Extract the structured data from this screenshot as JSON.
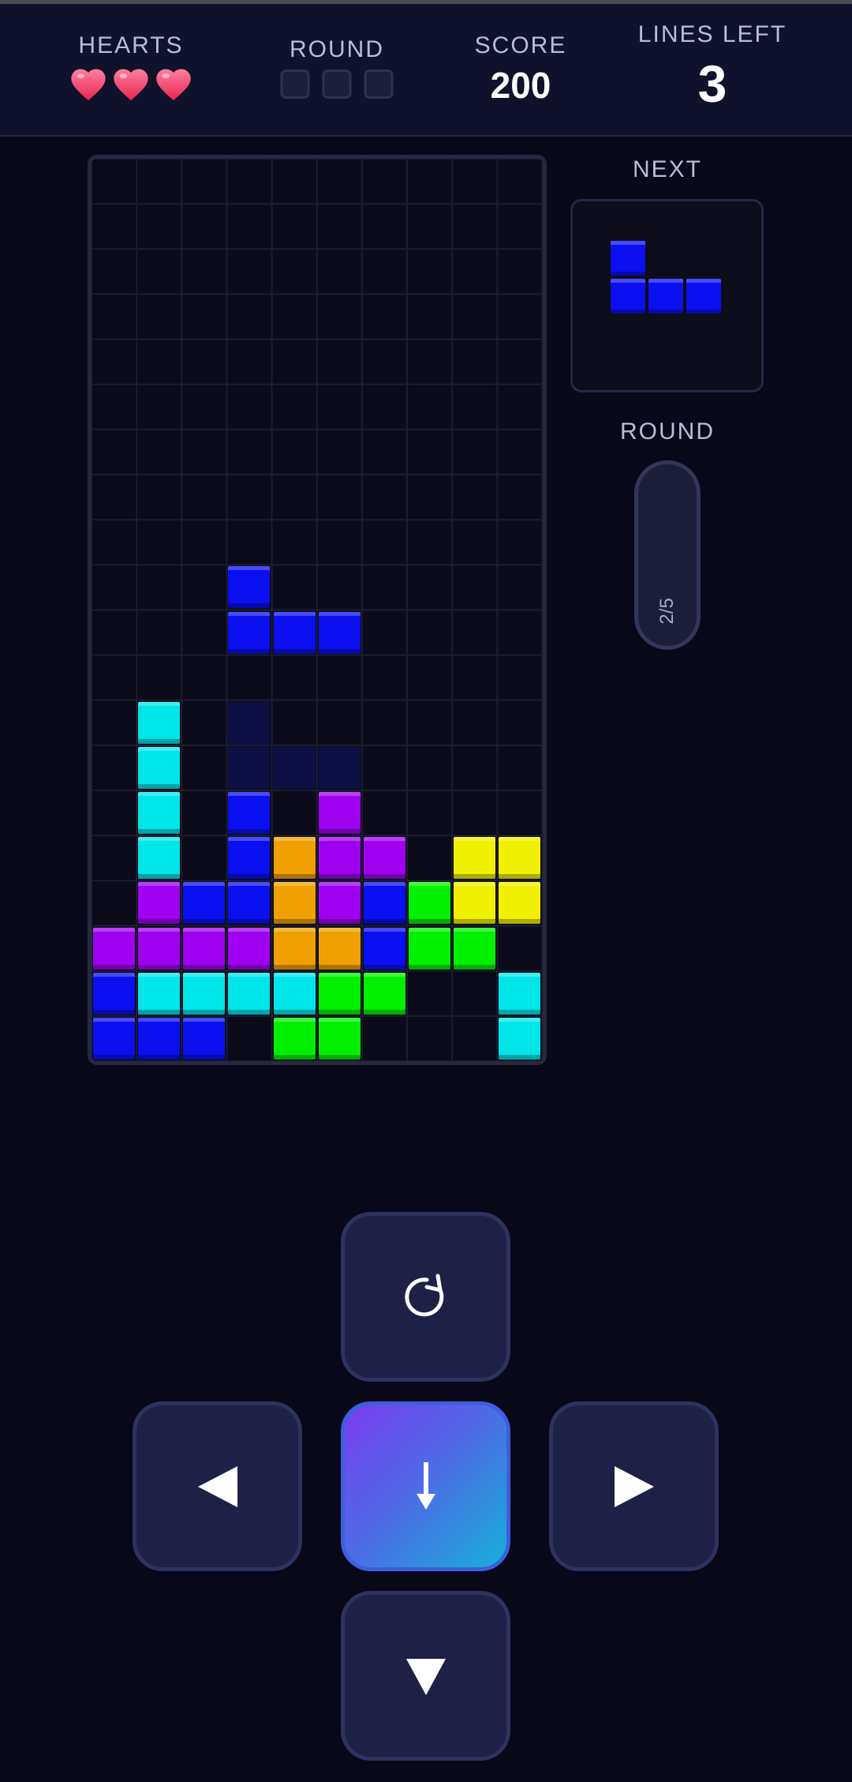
{
  "hud": {
    "hearts_label": "HEARTS",
    "hearts_count": 3,
    "round_label": "ROUND",
    "round_pips_total": 3,
    "round_pips_filled": 0,
    "score_label": "SCORE",
    "score_value": "200",
    "lines_label": "LINES LEFT",
    "lines_value": "3"
  },
  "sidebar": {
    "next_label": "NEXT",
    "next_piece": "J",
    "round_label": "ROUND",
    "round_progress": "2/5"
  },
  "colors": {
    "I": "#00e5e8",
    "J": "#0a10f0",
    "L": "#f0a000",
    "O": "#f0f000",
    "S": "#00f000",
    "T": "#a000f0",
    "ghost": "#0d0f45"
  },
  "board": {
    "cols": 10,
    "rows": 20,
    "rows_data": [
      "..........",
      "..........",
      "..........",
      "..........",
      "..........",
      "..........",
      "..........",
      "..........",
      "..........",
      "...J......",
      "...JJJ....",
      "..........",
      ".I.g......",
      ".I.ggg....",
      ".I.J.T....",
      ".I.JLTT.OO",
      ".TJJLTJSOO",
      "TTTTLLJSS.",
      "JIIIISS..I",
      "JJJ.SS...I"
    ]
  },
  "controls": {
    "rotate": "rotate-button",
    "left": "move-left-button",
    "drop": "hard-drop-button",
    "right": "move-right-button",
    "down": "soft-drop-button"
  }
}
